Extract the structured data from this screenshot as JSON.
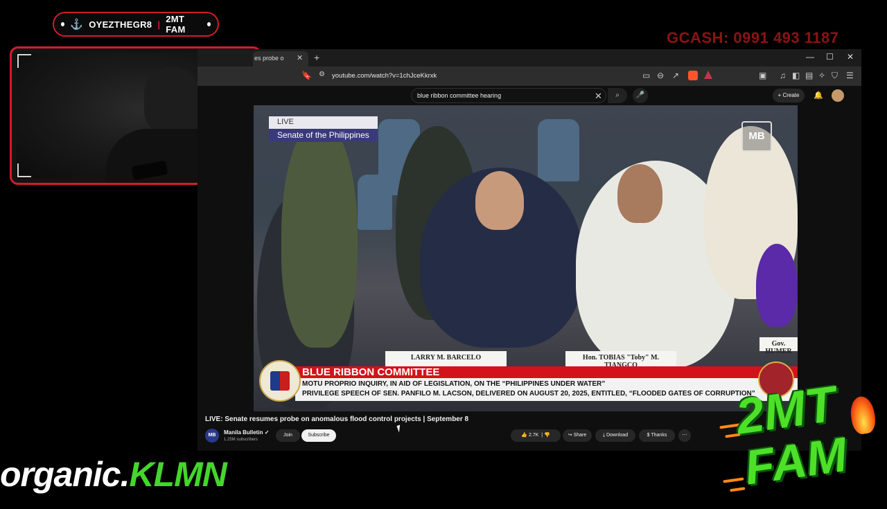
{
  "stream": {
    "pill_left": "OYEZTHEGR8",
    "pill_right": "2MT FAM",
    "gcash": "GCASH: 0991 493 1187",
    "organic_part1": "organic.",
    "organic_part2": "KLMN",
    "brand_line1": "2MT",
    "brand_line2": "FAM"
  },
  "browser": {
    "tab_title": "es probe o",
    "url": "youtube.com/watch?v=1chJceKkrxk"
  },
  "youtube": {
    "search_query": "blue ribbon committee hearing",
    "create_label": "Create",
    "video_title": "LIVE: Senate resumes probe on anomalous flood control projects | September 8",
    "channel_name": "Manila Bulletin",
    "subscribers": "1.25M subscribers",
    "join_label": "Join",
    "subscribe_label": "Subscribe",
    "likes": "2.7K",
    "share_label": "Share",
    "download_label": "Download",
    "thanks_label": "Thanks"
  },
  "video": {
    "live_label": "LIVE",
    "live_channel": "Senate of the Philippines",
    "watermark": "MB",
    "banner_title": "BLUE RIBBON COMMITTEE",
    "banner_line1": "MOTU PROPRIO INQUIRY, IN AID OF LEGISLATION, ON THE “PHILIPPINES UNDER WATER”",
    "banner_line2": "PRIVILEGE SPEECH OF SEN. PANFILO M. LACSON, DELIVERED ON AUGUST 20, 2025, ENTITLED, “FLOODED GATES OF CORRUPTION”",
    "nameplate_1": "LARRY M. BARCELO",
    "nameplate_2": "Hon. TOBIAS \"Toby\" M. TIANGCO",
    "nameplate_3": "Gov. HUMER"
  },
  "colors": {
    "accent_red": "#d41c2a",
    "banner_red": "#d4121b",
    "brand_green": "#4ee028"
  }
}
